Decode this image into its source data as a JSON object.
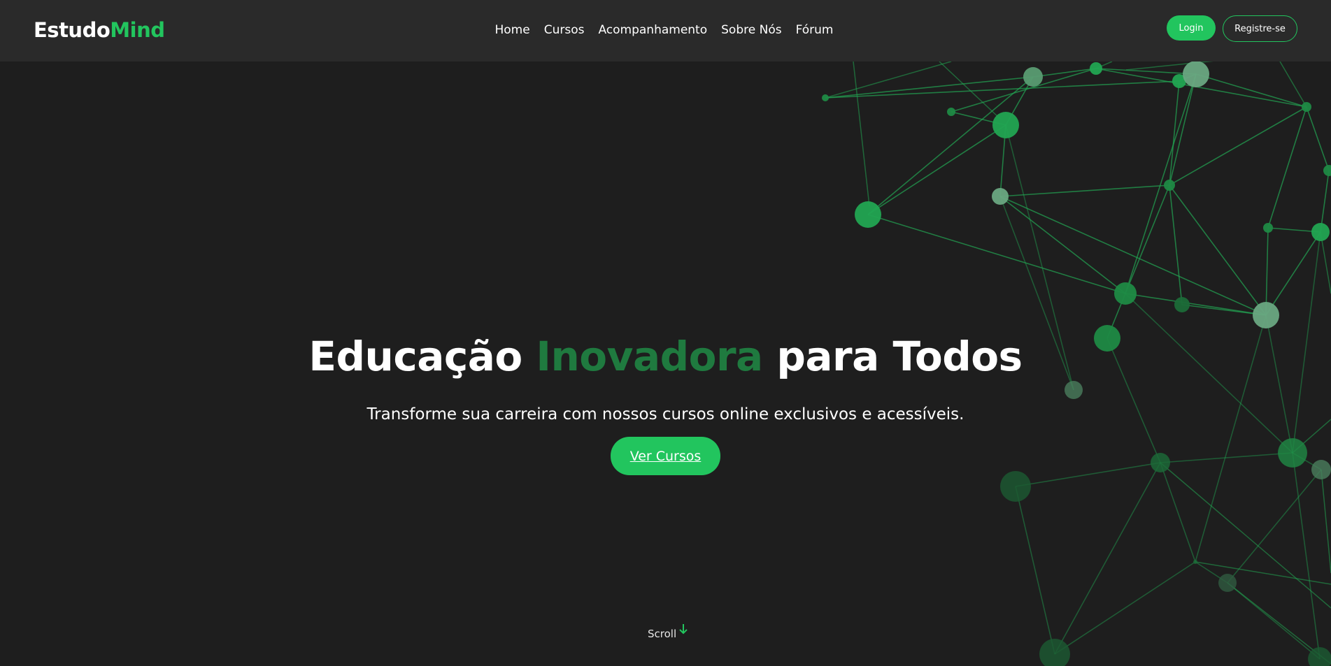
{
  "brand": {
    "part1": "Estudo",
    "part2": "Mind",
    "accent_color": "#22c55e"
  },
  "nav": {
    "links": [
      "Home",
      "Cursos",
      "Acompanhamento",
      "Sobre Nós",
      "Fórum"
    ]
  },
  "auth": {
    "login_label": "Login",
    "register_label": "Registre-se"
  },
  "hero": {
    "title_part1": "Educação ",
    "title_accent": "Inovadora",
    "title_part2": " para Todos",
    "subtitle": "Transforme sua carreira com nossos cursos online exclusivos e acessíveis.",
    "cta_label": "Ver Cursos"
  },
  "scroll": {
    "label": "Scroll",
    "icon": "arrow-down-icon"
  },
  "colors": {
    "background": "#1e1e1e",
    "navbar": "#2a2a2a",
    "primary": "#22c55e",
    "title_accent": "#1f7a3f",
    "network": "#22c55e"
  }
}
